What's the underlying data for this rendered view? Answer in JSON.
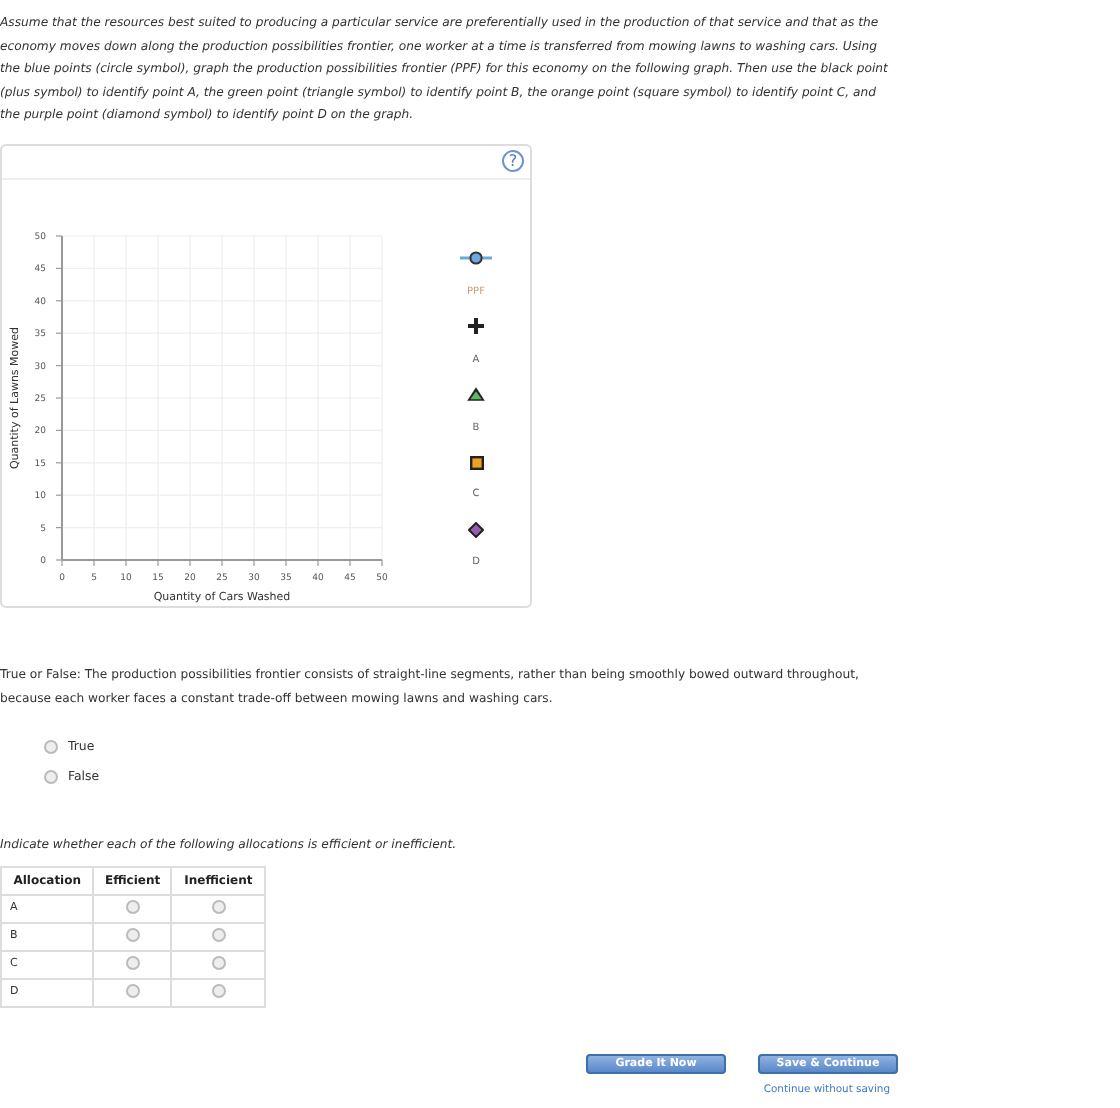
{
  "intro": "Assume that the resources best suited to producing a particular service are preferentially used in the production of that service and that as the economy moves down along the production possibilities frontier, one worker at a time is transferred from mowing lawns to washing cars. Using the blue points (circle symbol), graph the production possibilities frontier (PPF) for this economy on the following graph. Then use the black point (plus symbol) to identify point A, the green point (triangle symbol) to identify point B, the orange point (square symbol) to identify point C, and the purple point (diamond symbol) to identify point D on the graph.",
  "graph": {
    "help": "?",
    "chart_data": {
      "type": "scatter",
      "grid": true,
      "xlabel": "Quantity of Cars Washed",
      "ylabel": "Quantity of Lawns Mowed",
      "xlim": [
        0,
        50
      ],
      "ylim": [
        0,
        50
      ],
      "xticks": [
        0,
        5,
        10,
        15,
        20,
        25,
        30,
        35,
        40,
        45,
        50
      ],
      "yticks": [
        0,
        5,
        10,
        15,
        20,
        25,
        30,
        35,
        40,
        45,
        50
      ]
    },
    "tools": [
      {
        "kind": "circle",
        "color": "#6fa8dc",
        "label": "PPF"
      },
      {
        "kind": "plus",
        "color": "#222222",
        "label": "A"
      },
      {
        "kind": "triangle",
        "color": "#5cb85c",
        "label": "B"
      },
      {
        "kind": "square",
        "color": "#f0a020",
        "label": "C"
      },
      {
        "kind": "diamond",
        "color": "#9b59b6",
        "label": "D"
      }
    ]
  },
  "question": {
    "text": "True or False: The production possibilities frontier consists of straight-line segments, rather than being smoothly bowed outward throughout, because each worker faces a constant trade-off between mowing lawns and washing cars.",
    "options": [
      {
        "label": "True",
        "selected": false
      },
      {
        "label": "False",
        "selected": false
      }
    ]
  },
  "instruction": "Indicate whether each of the following allocations is efficient or inefficient.",
  "table": {
    "columns": [
      "Allocation",
      "Efficient",
      "Inefficient"
    ],
    "rows": [
      {
        "label": "A",
        "efficient": false,
        "inefficient": false
      },
      {
        "label": "B",
        "efficient": false,
        "inefficient": false
      },
      {
        "label": "C",
        "efficient": false,
        "inefficient": false
      },
      {
        "label": "D",
        "efficient": false,
        "inefficient": false
      }
    ]
  },
  "buttons": [
    "Grade It Now",
    "Save & Continue"
  ],
  "link": "Continue without saving"
}
